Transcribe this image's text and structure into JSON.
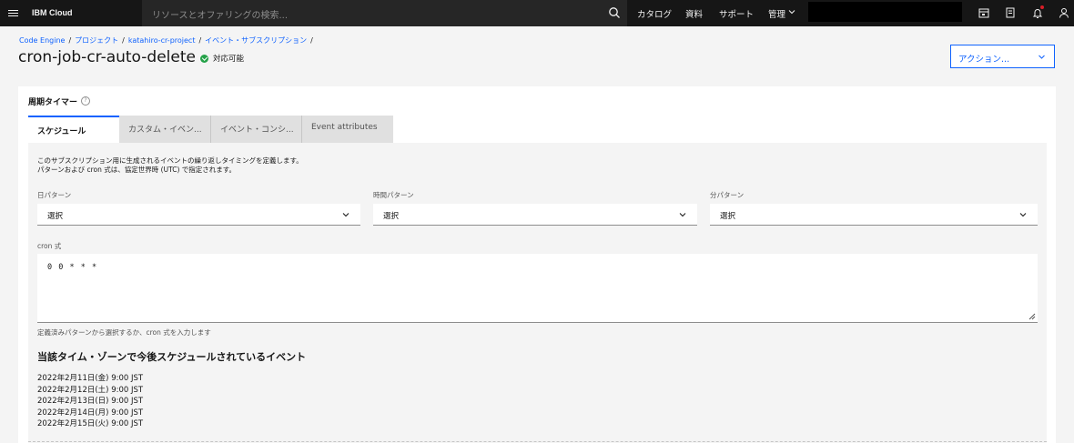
{
  "topbar": {
    "brand": "IBM Cloud",
    "search_placeholder": "リソースとオファリングの検索...",
    "nav": [
      "カタログ",
      "資料",
      "サポート",
      "管理"
    ]
  },
  "breadcrumb": [
    "Code Engine",
    "プロジェクト",
    "katahiro-cr-project",
    "イベント・サブスクリプション"
  ],
  "page": {
    "title": "cron-job-cr-auto-delete",
    "status": "対応可能",
    "action_label": "アクション..."
  },
  "section": {
    "label": "周期タイマー",
    "tabs": [
      "スケジュール",
      "カスタム・イベン...",
      "イベント・コンシ...",
      "Event attributes"
    ],
    "description": [
      "このサブスクリプション用に生成されるイベントの繰り返しタイミングを定義します。",
      "パターンおよび cron 式は、協定世界時 (UTC) で指定されます。"
    ],
    "fields": [
      {
        "label": "日パターン",
        "value": "選択"
      },
      {
        "label": "時間パターン",
        "value": "選択"
      },
      {
        "label": "分パターン",
        "value": "選択"
      }
    ],
    "cron_label": "cron 式",
    "cron_value": "0 0 * * *",
    "helper": "定義済みパターンから選択するか、cron 式を入力します",
    "events_title": "当該タイム・ゾーンで今後スケジュールされているイベント",
    "events": [
      "2022年2月11日(金) 9:00 JST",
      "2022年2月12日(土) 9:00 JST",
      "2022年2月13日(日) 9:00 JST",
      "2022年2月14日(月) 9:00 JST",
      "2022年2月15日(火) 9:00 JST"
    ]
  },
  "colors": {
    "accent": "#0f62fe",
    "nav_bg": "#161616",
    "status_ok": "#24a148"
  }
}
